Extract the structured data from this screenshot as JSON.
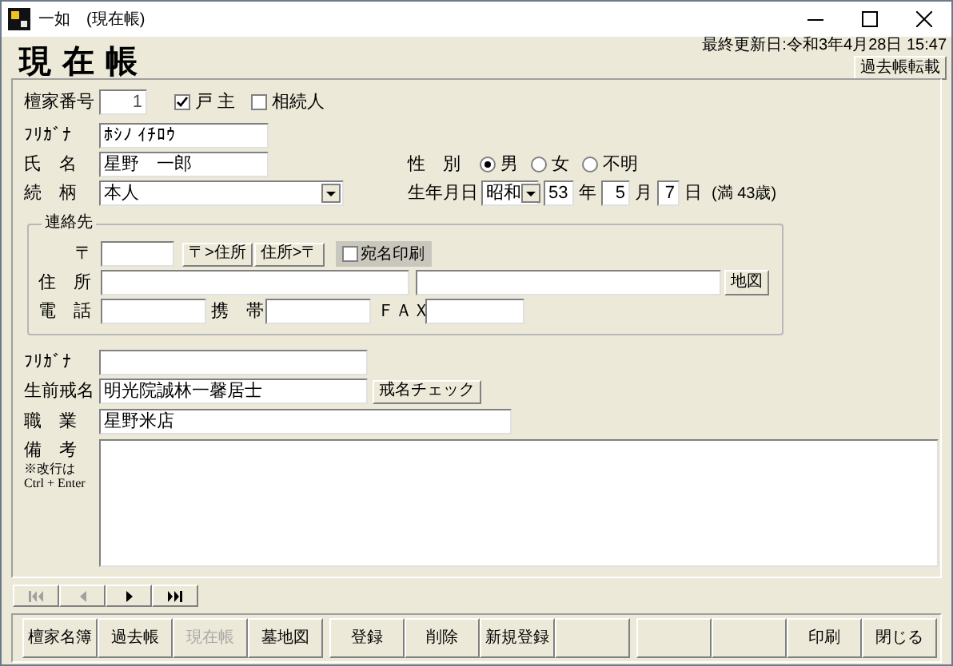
{
  "window": {
    "title": "一如　(現在帳)"
  },
  "header": {
    "title": "現 在 帳",
    "last_updated": "最終更新日:令和3年4月28日 15:47",
    "button": "過去帳転載"
  },
  "danka": {
    "label": "檀家番号",
    "value": "1",
    "options": [
      {
        "label": "戸 主",
        "checked": true
      },
      {
        "label": "相続人",
        "checked": false
      }
    ]
  },
  "furigana": {
    "label": "ﾌﾘｶﾞﾅ",
    "value": "ﾎｼﾉ ｲﾁﾛｳ"
  },
  "name": {
    "label": "氏　名",
    "value": "星野　一郎"
  },
  "sex": {
    "label": "性　別",
    "options": [
      {
        "label": "男",
        "selected": true
      },
      {
        "label": "女",
        "selected": false
      },
      {
        "label": "不明",
        "selected": false
      }
    ]
  },
  "relation": {
    "label": "続　柄",
    "value": "本人"
  },
  "birth": {
    "label": "生年月日",
    "era": "昭和",
    "year": "53",
    "year_unit": "年",
    "month": "5",
    "month_unit": "月",
    "day": "7",
    "day_unit": "日",
    "age": "(満 43歳)"
  },
  "contact": {
    "title": "連絡先",
    "postal_label": "〒",
    "buttons": [
      "〒>住所",
      "住所>〒"
    ],
    "print_option": {
      "label": "宛名印刷",
      "checked": false
    },
    "address_label": "住　所",
    "map_button": "地図",
    "phone_label": "電　話",
    "mobile_label": "携　帯",
    "fax_label": "ＦＡＸ"
  },
  "posthumous": {
    "furigana_label": "ﾌﾘｶﾞﾅ",
    "label": "生前戒名",
    "value": "明光院誠林一馨居士",
    "button": "戒名チェック"
  },
  "occupation": {
    "label": "職　業",
    "value": "星野米店"
  },
  "notes": {
    "label": "備　考",
    "hint": "※改行は\nCtrl + Enter"
  },
  "navigation": [
    {
      "kind": "first",
      "disabled": true
    },
    {
      "kind": "prev",
      "disabled": true
    },
    {
      "kind": "next",
      "disabled": false
    },
    {
      "kind": "last",
      "disabled": false
    }
  ],
  "footer": {
    "groups": [
      [
        {
          "kind": "command",
          "label": "檀家名簿",
          "disabled": false
        },
        {
          "kind": "command",
          "label": "過去帳",
          "disabled": false
        },
        {
          "kind": "command",
          "label": "現在帳",
          "disabled": true
        },
        {
          "kind": "command",
          "label": "墓地図",
          "disabled": false
        }
      ],
      [
        {
          "kind": "command",
          "label": "登録",
          "disabled": false
        },
        {
          "kind": "command",
          "label": "削除",
          "disabled": false
        },
        {
          "kind": "command",
          "label": "新規登録",
          "disabled": false
        },
        {
          "kind": "blank"
        }
      ],
      [
        {
          "kind": "blank"
        },
        {
          "kind": "blank"
        },
        {
          "kind": "command",
          "label": "印刷",
          "disabled": false
        },
        {
          "kind": "command",
          "label": "閉じる",
          "disabled": false
        }
      ]
    ]
  }
}
